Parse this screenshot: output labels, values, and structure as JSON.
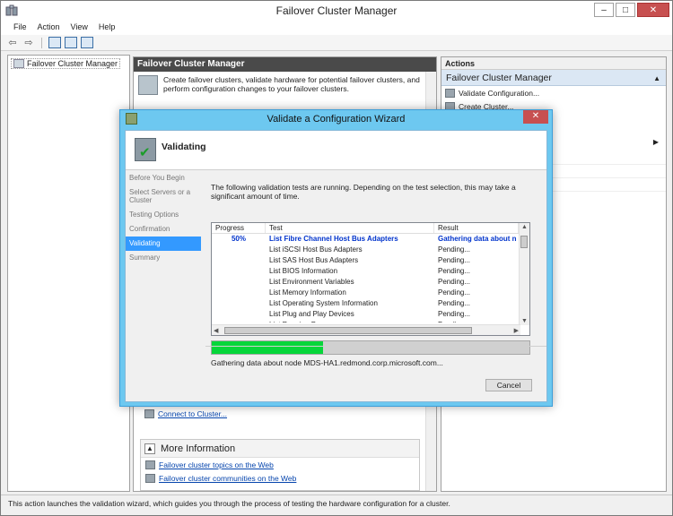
{
  "window": {
    "title": "Failover Cluster Manager",
    "controls": {
      "minimize": "–",
      "maximize": "□",
      "close": "✕"
    }
  },
  "menu": [
    "File",
    "Action",
    "View",
    "Help"
  ],
  "tree": {
    "root": "Failover Cluster Manager"
  },
  "center": {
    "header": "Failover Cluster Manager",
    "description": "Create failover clusters, validate hardware for potential failover clusters, and perform configuration changes to your failover clusters.",
    "connect_link": "Connect to Cluster...",
    "more_info": {
      "title": "More Information",
      "links": [
        "Failover cluster topics on the Web",
        "Failover cluster communities on the Web"
      ]
    }
  },
  "actions": {
    "title": "Actions",
    "group": "Failover Cluster Manager",
    "items": [
      "Validate Configuration...",
      "Create Cluster..."
    ]
  },
  "status_bar": "This action launches the validation wizard, which guides you through the process of testing the hardware configuration for a cluster.",
  "wizard": {
    "title": "Validate a Configuration Wizard",
    "close": "✕",
    "page_title": "Validating",
    "steps": [
      {
        "label": "Before You Begin",
        "active": false
      },
      {
        "label": "Select Servers or a Cluster",
        "active": false
      },
      {
        "label": "Testing Options",
        "active": false
      },
      {
        "label": "Confirmation",
        "active": false
      },
      {
        "label": "Validating",
        "active": true
      },
      {
        "label": "Summary",
        "active": false
      }
    ],
    "intro": "The following validation tests are running. Depending on the test selection, this may take a significant amount of time.",
    "columns": {
      "progress": "Progress",
      "test": "Test",
      "result": "Result"
    },
    "tests": [
      {
        "progress": "50%",
        "test": "List Fibre Channel Host Bus Adapters",
        "result": "Gathering data about n"
      },
      {
        "progress": "",
        "test": "List iSCSI Host Bus Adapters",
        "result": "Pending..."
      },
      {
        "progress": "",
        "test": "List SAS Host Bus Adapters",
        "result": "Pending..."
      },
      {
        "progress": "",
        "test": "List BIOS Information",
        "result": "Pending..."
      },
      {
        "progress": "",
        "test": "List Environment Variables",
        "result": "Pending..."
      },
      {
        "progress": "",
        "test": "List Memory Information",
        "result": "Pending..."
      },
      {
        "progress": "",
        "test": "List Operating System Information",
        "result": "Pending..."
      },
      {
        "progress": "",
        "test": "List Plug and Play Devices",
        "result": "Pending..."
      },
      {
        "progress": "",
        "test": "List Running Processes",
        "result": "Pending..."
      }
    ],
    "progress_fraction": 0.35,
    "progress_text": "Gathering data about node MDS-HA1.redmond.corp.microsoft.com...",
    "cancel": "Cancel",
    "colors": {
      "progress_fill": "#06d63a",
      "active_step": "#3399ff",
      "titlebar": "#6dc8f0"
    }
  }
}
